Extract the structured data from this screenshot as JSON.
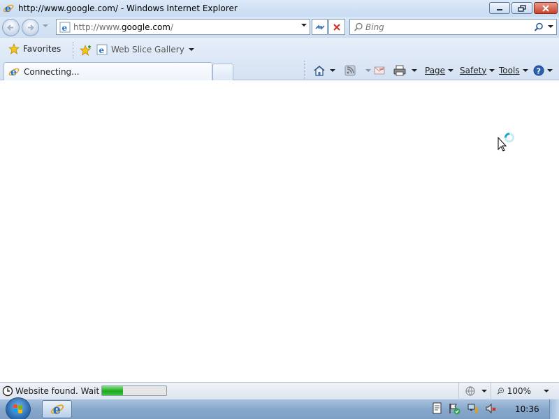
{
  "window": {
    "title": "http://www.google.com/ - Windows Internet Explorer"
  },
  "address_bar": {
    "url_prefix": "http://www.",
    "url_domain": "google.com",
    "url_suffix": "/"
  },
  "search": {
    "placeholder": "Bing"
  },
  "favorites_bar": {
    "favorites_label": "Favorites",
    "web_slice_label": "Web Slice Gallery"
  },
  "tab": {
    "label": "Connecting..."
  },
  "command_bar": {
    "page_label": "Page",
    "safety_label": "Safety",
    "tools_label": "Tools"
  },
  "status_bar": {
    "text": "Website found. Waitin",
    "progress_fraction": 0.33,
    "zoom_label": "100%"
  },
  "taskbar": {
    "clock": "10:36"
  },
  "colors": {
    "progress_fill": "#1fa61f",
    "ie_blue": "#1f6fc6",
    "stop_red": "#d42a1e"
  }
}
